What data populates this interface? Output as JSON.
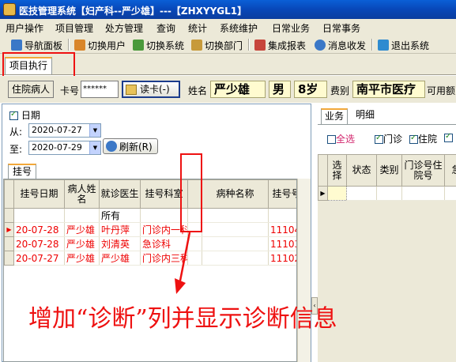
{
  "window": {
    "title": "医技管理系统【妇产科--严少雄】---【ZHXYYGL1】"
  },
  "menubar": {
    "items": [
      "用户操作",
      "项目管理",
      "处方管理",
      "查询",
      "统计",
      "系统维护",
      "日常业务",
      "日常事务"
    ]
  },
  "toolbar": {
    "items": [
      {
        "label": "导航面板",
        "icon": "navigation-panel-icon"
      },
      {
        "label": "切换用户",
        "icon": "switch-user-icon"
      },
      {
        "label": "切换系统",
        "icon": "switch-system-icon"
      },
      {
        "label": "切换部门",
        "icon": "switch-department-icon"
      },
      {
        "label": "集成报表",
        "icon": "report-icon"
      },
      {
        "label": "消息收发",
        "icon": "message-icon"
      },
      {
        "label": "退出系统",
        "icon": "exit-icon"
      }
    ]
  },
  "main_tab": {
    "label": "项目执行"
  },
  "patient": {
    "type_button": "住院病人",
    "card_label": "卡号",
    "card_value": "******",
    "read_card_button": "读卡(-)",
    "name_label": "姓名",
    "name": "严少雄",
    "gender": "男",
    "age": "8岁",
    "fee_label": "费别",
    "fee_type": "南平市医疗",
    "balance_label": "可用额"
  },
  "filter": {
    "date_label": "日期",
    "date_checked": true,
    "from_label": "从:",
    "from_date": "2020-07-27",
    "to_label": "至:",
    "to_date": "2020-07-29",
    "refresh_button": "刷新(R)"
  },
  "left_tab": {
    "label": "挂号"
  },
  "left_grid": {
    "columns": [
      "挂号日期",
      "病人姓名",
      "就诊医生",
      "挂号科室",
      "",
      "病种名称",
      "挂号号"
    ],
    "filter_row": [
      "",
      "",
      "所有",
      "",
      "",
      "",
      ""
    ],
    "rows": [
      {
        "current": true,
        "cells": [
          "20-07-28",
          "严少雄",
          "叶丹萍",
          "门诊内一科",
          "",
          "",
          "11104"
        ]
      },
      {
        "current": false,
        "cells": [
          "20-07-28",
          "严少雄",
          "刘清英",
          "急诊科",
          "",
          "",
          "11103"
        ]
      },
      {
        "current": false,
        "cells": [
          "20-07-27",
          "严少雄",
          "严少雄",
          "门诊内三科",
          "",
          "",
          "11102"
        ]
      }
    ]
  },
  "right_tabs": [
    "业务",
    "明细"
  ],
  "right_filter": {
    "select_all": "全选",
    "select_all_checked": false,
    "outpatient": "门诊",
    "outpatient_checked": true,
    "inpatient": "住院",
    "inpatient_checked": true
  },
  "right_grid": {
    "columns": [
      "选择",
      "状态",
      "类别",
      "门诊号住院号",
      "急"
    ]
  },
  "annotation": {
    "text": "增加“诊断”列并显示诊断信息",
    "color": "#e11111"
  },
  "colors": {
    "title_bar": "#0847b8",
    "window_bg": "#ece9d8",
    "highlight_yellow": "#fffbd0",
    "annotation_red": "#e11111",
    "tab_accent": "#f2a83a"
  }
}
